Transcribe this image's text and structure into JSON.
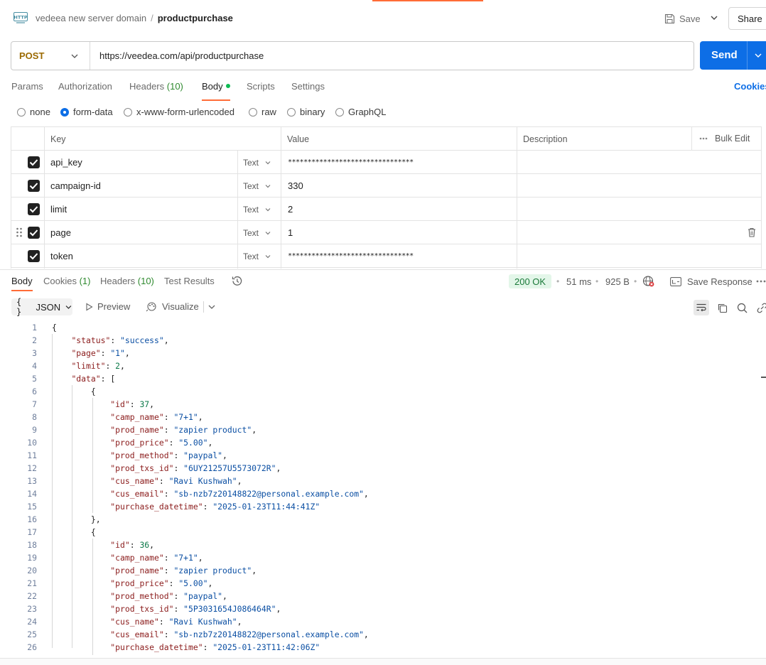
{
  "header": {
    "collection": "vedeea new server domain",
    "separator": "/",
    "request_name": "productpurchase",
    "save_label": "Save",
    "share_label": "Share"
  },
  "request": {
    "method": "POST",
    "url": "https://veedea.com/api/productpurchase",
    "send_label": "Send"
  },
  "request_tabs": {
    "params": "Params",
    "authorization": "Authorization",
    "headers": "Headers",
    "headers_count": "(10)",
    "body": "Body",
    "scripts": "Scripts",
    "settings": "Settings",
    "cookies": "Cookies"
  },
  "body_types": {
    "none": "none",
    "form_data": "form-data",
    "urlencoded": "x-www-form-urlencoded",
    "raw": "raw",
    "binary": "binary",
    "graphql": "GraphQL",
    "selected": "form-data"
  },
  "params_table": {
    "headers": {
      "key": "Key",
      "value": "Value",
      "description": "Description",
      "bulk_edit": "Bulk Edit"
    },
    "rows": [
      {
        "key": "api_key",
        "type": "Text",
        "value": "********************************",
        "checked": true
      },
      {
        "key": "campaign-id",
        "type": "Text",
        "value": "330",
        "checked": true
      },
      {
        "key": "limit",
        "type": "Text",
        "value": "2",
        "checked": true
      },
      {
        "key": "page",
        "type": "Text",
        "value": "1",
        "checked": true
      },
      {
        "key": "token",
        "type": "Text",
        "value": "********************************",
        "checked": true
      }
    ]
  },
  "response": {
    "tabs": {
      "body": "Body",
      "cookies": "Cookies",
      "cookies_count": "(1)",
      "headers": "Headers",
      "headers_count": "(10)",
      "test_results": "Test Results"
    },
    "status": "200 OK",
    "time": "51 ms",
    "size": "925 B",
    "save_response": "Save Response",
    "format": "JSON",
    "preview": "Preview",
    "visualize": "Visualize"
  },
  "code": {
    "line_numbers": [
      "1",
      "2",
      "3",
      "4",
      "5",
      "6",
      "7",
      "8",
      "9",
      "10",
      "11",
      "12",
      "13",
      "14",
      "15",
      "16",
      "17",
      "18",
      "19",
      "20",
      "21",
      "22",
      "23",
      "24",
      "25",
      "26"
    ],
    "lines": [
      "{",
      "    \"status\": \"success\",",
      "    \"page\": \"1\",",
      "    \"limit\": 2,",
      "    \"data\": [",
      "        {",
      "            \"id\": 37,",
      "            \"camp_name\": \"7+1\",",
      "            \"prod_name\": \"zapier product\",",
      "            \"prod_price\": \"5.00\",",
      "            \"prod_method\": \"paypal\",",
      "            \"prod_txs_id\": \"6UY21257U5573072R\",",
      "            \"cus_name\": \"Ravi Kushwah\",",
      "            \"cus_email\": \"sb-nzb7z20148822@personal.example.com\",",
      "            \"purchase_datetime\": \"2025-01-23T11:44:41Z\"",
      "        },",
      "        {",
      "            \"id\": 36,",
      "            \"camp_name\": \"7+1\",",
      "            \"prod_name\": \"zapier product\",",
      "            \"prod_price\": \"5.00\",",
      "            \"prod_method\": \"paypal\",",
      "            \"prod_txs_id\": \"5P3031654J086464R\",",
      "            \"cus_name\": \"Ravi Kushwah\",",
      "            \"cus_email\": \"sb-nzb7z20148822@personal.example.com\",",
      "            \"purchase_datetime\": \"2025-01-23T11:42:06Z\""
    ]
  },
  "colors": {
    "accent": "#ff6c37",
    "send": "#0d6ee6",
    "method": "#9b6a00",
    "status_bg": "#e3f6e9",
    "status_fg": "#1b7a3a",
    "json_key": "#8b1c1c",
    "json_string": "#0b4fa3",
    "json_number": "#0d7a4a"
  },
  "icons": [
    "http-icon",
    "save-icon",
    "chevron-down-icon",
    "drag-handle-icon",
    "checkbox-icon",
    "trash-icon",
    "history-icon",
    "globe-icon",
    "save-response-icon",
    "more-icon",
    "braces-icon",
    "play-icon",
    "visualize-icon",
    "wrap-icon",
    "copy-icon",
    "search-icon",
    "link-icon"
  ]
}
